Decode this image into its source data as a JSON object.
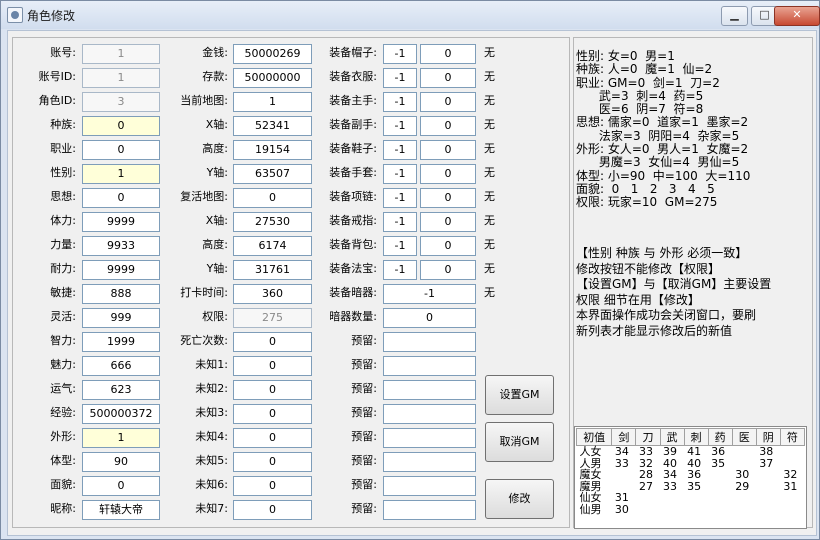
{
  "window": {
    "title": "角色修改",
    "min": "▁",
    "max": "□",
    "close": "✕"
  },
  "col1": [
    {
      "label": "账号:",
      "value": "1",
      "state": "ro"
    },
    {
      "label": "账号ID:",
      "value": "1",
      "state": "ro"
    },
    {
      "label": "角色ID:",
      "value": "3",
      "state": "ro"
    },
    {
      "label": "种族:",
      "value": "0",
      "state": "hi"
    },
    {
      "label": "职业:",
      "value": "0",
      "state": ""
    },
    {
      "label": "性别:",
      "value": "1",
      "state": "hi"
    },
    {
      "label": "思想:",
      "value": "0",
      "state": ""
    },
    {
      "label": "体力:",
      "value": "9999",
      "state": ""
    },
    {
      "label": "力量:",
      "value": "9933",
      "state": ""
    },
    {
      "label": "耐力:",
      "value": "9999",
      "state": ""
    },
    {
      "label": "敏捷:",
      "value": "888",
      "state": ""
    },
    {
      "label": "灵活:",
      "value": "999",
      "state": ""
    },
    {
      "label": "智力:",
      "value": "1999",
      "state": ""
    },
    {
      "label": "魅力:",
      "value": "666",
      "state": ""
    },
    {
      "label": "运气:",
      "value": "623",
      "state": ""
    },
    {
      "label": "经验:",
      "value": "500000372",
      "state": ""
    },
    {
      "label": "外形:",
      "value": "1",
      "state": "hi"
    },
    {
      "label": "体型:",
      "value": "90",
      "state": ""
    },
    {
      "label": "面貌:",
      "value": "0",
      "state": ""
    },
    {
      "label": "昵称:",
      "value": "轩辕大帝",
      "state": ""
    }
  ],
  "col2": [
    {
      "label": "金钱:",
      "value": "50000269",
      "state": ""
    },
    {
      "label": "存款:",
      "value": "50000000",
      "state": ""
    },
    {
      "label": "当前地图:",
      "value": "1",
      "state": ""
    },
    {
      "label": "X轴:",
      "value": "52341",
      "state": ""
    },
    {
      "label": "高度:",
      "value": "19154",
      "state": ""
    },
    {
      "label": "Y轴:",
      "value": "63507",
      "state": ""
    },
    {
      "label": "复活地图:",
      "value": "0",
      "state": ""
    },
    {
      "label": "X轴:",
      "value": "27530",
      "state": ""
    },
    {
      "label": "高度:",
      "value": "6174",
      "state": ""
    },
    {
      "label": "Y轴:",
      "value": "31761",
      "state": ""
    },
    {
      "label": "打卡时间:",
      "value": "360",
      "state": ""
    },
    {
      "label": "权限:",
      "value": "275",
      "state": "ro"
    },
    {
      "label": "死亡次数:",
      "value": "0",
      "state": ""
    },
    {
      "label": "未知1:",
      "value": "0",
      "state": ""
    },
    {
      "label": "未知2:",
      "value": "0",
      "state": ""
    },
    {
      "label": "未知3:",
      "value": "0",
      "state": ""
    },
    {
      "label": "未知4:",
      "value": "0",
      "state": ""
    },
    {
      "label": "未知5:",
      "value": "0",
      "state": ""
    },
    {
      "label": "未知6:",
      "value": "0",
      "state": ""
    },
    {
      "label": "未知7:",
      "value": "0",
      "state": ""
    }
  ],
  "equip": [
    {
      "label": "装备帽子:",
      "a": "-1",
      "b": "0",
      "unit": "无"
    },
    {
      "label": "装备衣服:",
      "a": "-1",
      "b": "0",
      "unit": "无"
    },
    {
      "label": "装备主手:",
      "a": "-1",
      "b": "0",
      "unit": "无"
    },
    {
      "label": "装备副手:",
      "a": "-1",
      "b": "0",
      "unit": "无"
    },
    {
      "label": "装备鞋子:",
      "a": "-1",
      "b": "0",
      "unit": "无"
    },
    {
      "label": "装备手套:",
      "a": "-1",
      "b": "0",
      "unit": "无"
    },
    {
      "label": "装备项链:",
      "a": "-1",
      "b": "0",
      "unit": "无"
    },
    {
      "label": "装备戒指:",
      "a": "-1",
      "b": "0",
      "unit": "无"
    },
    {
      "label": "装备背包:",
      "a": "-1",
      "b": "0",
      "unit": "无"
    },
    {
      "label": "装备法宝:",
      "a": "-1",
      "b": "0",
      "unit": "无"
    },
    {
      "label": "装备暗器:",
      "wide": "-1",
      "unit": "无"
    },
    {
      "label": "暗器数量:",
      "wide": "0",
      "unit": ""
    },
    {
      "label": "预留:",
      "wide": "",
      "unit": ""
    },
    {
      "label": "预留:",
      "wide": "",
      "unit": ""
    },
    {
      "label": "预留:",
      "wide": "",
      "unit": ""
    },
    {
      "label": "预留:",
      "wide": "",
      "unit": ""
    },
    {
      "label": "预留:",
      "wide": "",
      "unit": ""
    },
    {
      "label": "预留:",
      "wide": "",
      "unit": ""
    },
    {
      "label": "预留:",
      "wide": "",
      "unit": ""
    },
    {
      "label": "预留:",
      "wide": "",
      "unit": ""
    }
  ],
  "buttons": {
    "set_gm": "设置GM",
    "cancel_gm": "取消GM",
    "modify": "修改"
  },
  "info": {
    "lines": [
      "性别: 女=0  男=1",
      "种族: 人=0  魔=1  仙=2",
      "职业: GM=0  剑=1  刀=2",
      "      武=3  刺=4  药=5",
      "      医=6  阴=7  符=8",
      "思想: 儒家=0  道家=1  墨家=2",
      "      法家=3  阴阳=4  杂家=5",
      "外形: 女人=0  男人=1  女魔=2",
      "      男魔=3  女仙=4  男仙=5",
      "体型: 小=90  中=100  大=110",
      "面貌:  0   1   2   3   4   5",
      "权限: 玩家=10  GM=275"
    ],
    "notes": [
      "【性别 种族 与 外形 必须一致】",
      "修改按钮不能修改【权限】",
      "【设置GM】与【取消GM】主要设置",
      "权限 细节在用【修改】",
      "本界面操作成功会关闭窗口，要刷",
      "新列表才能显示修改后的新值"
    ]
  },
  "stats_table": {
    "headers": [
      "初值",
      "剑",
      "刀",
      "武",
      "刺",
      "药",
      "医",
      "阴",
      "符"
    ],
    "rows": [
      [
        "人女",
        "34",
        "33",
        "39",
        "41",
        "36",
        "",
        "38",
        ""
      ],
      [
        "人男",
        "33",
        "32",
        "40",
        "40",
        "35",
        "",
        "37",
        ""
      ],
      [
        "魔女",
        "",
        "28",
        "34",
        "36",
        "",
        "30",
        "",
        "32"
      ],
      [
        "魔男",
        "",
        "27",
        "33",
        "35",
        "",
        "29",
        "",
        "31"
      ],
      [
        "仙女",
        "31",
        "",
        "",
        "",
        "",
        "",
        "",
        ""
      ],
      [
        "仙男",
        "30",
        "",
        "",
        "",
        "",
        "",
        "",
        ""
      ]
    ]
  }
}
